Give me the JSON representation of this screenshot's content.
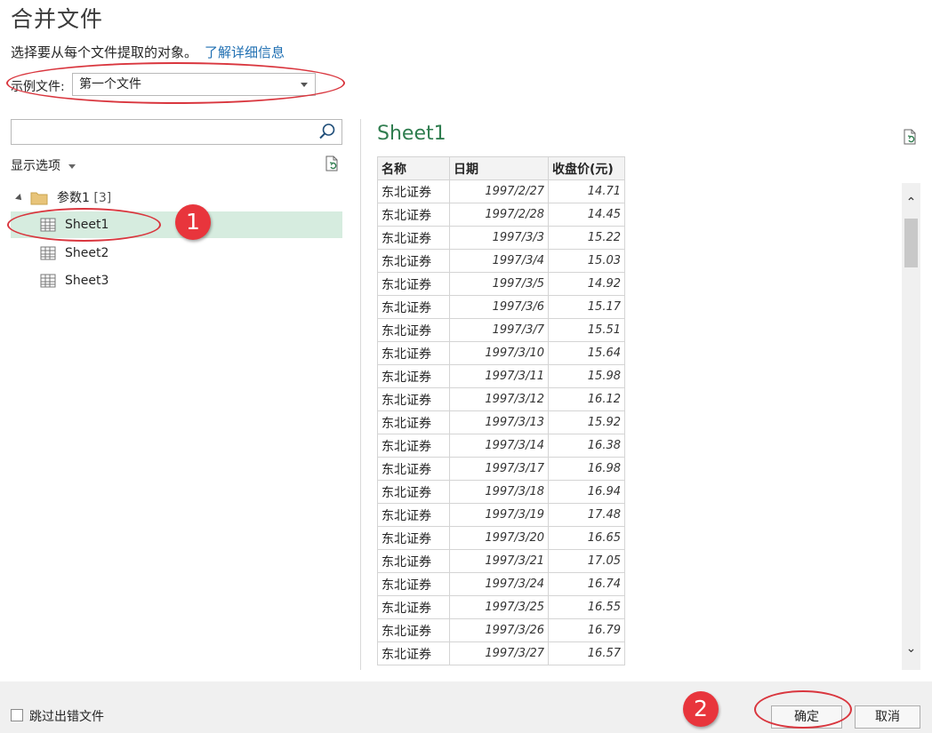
{
  "dialog": {
    "title": "合并文件",
    "subtitle": "选择要从每个文件提取的对象。",
    "learn_more_link": "了解详细信息"
  },
  "sample_file": {
    "label": "示例文件:",
    "selected": "第一个文件"
  },
  "navigator": {
    "search_placeholder": "",
    "display_options_label": "显示选项",
    "folder": {
      "name": "参数1",
      "count": "[3]"
    },
    "items": [
      {
        "label": "Sheet1",
        "selected": true
      },
      {
        "label": "Sheet2",
        "selected": false
      },
      {
        "label": "Sheet3",
        "selected": false
      }
    ]
  },
  "preview": {
    "title": "Sheet1",
    "columns": [
      "名称",
      "日期",
      "收盘价(元)"
    ],
    "rows": [
      [
        "东北证券",
        "1997/2/27",
        "14.71"
      ],
      [
        "东北证券",
        "1997/2/28",
        "14.45"
      ],
      [
        "东北证券",
        "1997/3/3",
        "15.22"
      ],
      [
        "东北证券",
        "1997/3/4",
        "15.03"
      ],
      [
        "东北证券",
        "1997/3/5",
        "14.92"
      ],
      [
        "东北证券",
        "1997/3/6",
        "15.17"
      ],
      [
        "东北证券",
        "1997/3/7",
        "15.51"
      ],
      [
        "东北证券",
        "1997/3/10",
        "15.64"
      ],
      [
        "东北证券",
        "1997/3/11",
        "15.98"
      ],
      [
        "东北证券",
        "1997/3/12",
        "16.12"
      ],
      [
        "东北证券",
        "1997/3/13",
        "15.92"
      ],
      [
        "东北证券",
        "1997/3/14",
        "16.38"
      ],
      [
        "东北证券",
        "1997/3/17",
        "16.98"
      ],
      [
        "东北证券",
        "1997/3/18",
        "16.94"
      ],
      [
        "东北证券",
        "1997/3/19",
        "17.48"
      ],
      [
        "东北证券",
        "1997/3/20",
        "16.65"
      ],
      [
        "东北证券",
        "1997/3/21",
        "17.05"
      ],
      [
        "东北证券",
        "1997/3/24",
        "16.74"
      ],
      [
        "东北证券",
        "1997/3/25",
        "16.55"
      ],
      [
        "东北证券",
        "1997/3/26",
        "16.79"
      ],
      [
        "东北证券",
        "1997/3/27",
        "16.57"
      ]
    ]
  },
  "footer": {
    "skip_errors_label": "跳过出错文件",
    "ok_label": "确定",
    "cancel_label": "取消"
  },
  "annotations": {
    "badge_1": "1",
    "badge_2": "2"
  },
  "colors": {
    "accent_green": "#2f7d4f",
    "selection": "#d6ecdf",
    "annotation_red": "#e8353c",
    "link": "#1f6fb2"
  },
  "icons": {
    "search": "search-icon",
    "refresh": "refresh-file-icon",
    "folder": "folder-icon",
    "sheet": "sheet-table-icon"
  }
}
